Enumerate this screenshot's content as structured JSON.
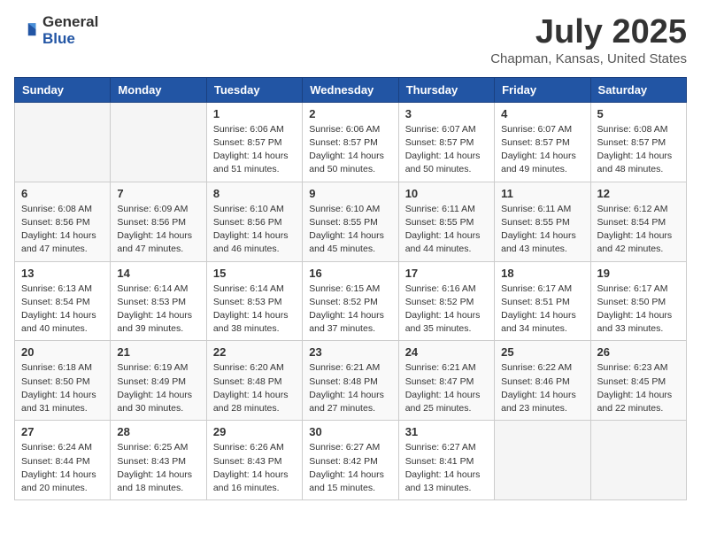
{
  "header": {
    "logo_general": "General",
    "logo_blue": "Blue",
    "title": "July 2025",
    "subtitle": "Chapman, Kansas, United States"
  },
  "weekdays": [
    "Sunday",
    "Monday",
    "Tuesday",
    "Wednesday",
    "Thursday",
    "Friday",
    "Saturday"
  ],
  "weeks": [
    [
      {
        "day": "",
        "sunrise": "",
        "sunset": "",
        "daylight": ""
      },
      {
        "day": "",
        "sunrise": "",
        "sunset": "",
        "daylight": ""
      },
      {
        "day": "1",
        "sunrise": "Sunrise: 6:06 AM",
        "sunset": "Sunset: 8:57 PM",
        "daylight": "Daylight: 14 hours and 51 minutes."
      },
      {
        "day": "2",
        "sunrise": "Sunrise: 6:06 AM",
        "sunset": "Sunset: 8:57 PM",
        "daylight": "Daylight: 14 hours and 50 minutes."
      },
      {
        "day": "3",
        "sunrise": "Sunrise: 6:07 AM",
        "sunset": "Sunset: 8:57 PM",
        "daylight": "Daylight: 14 hours and 50 minutes."
      },
      {
        "day": "4",
        "sunrise": "Sunrise: 6:07 AM",
        "sunset": "Sunset: 8:57 PM",
        "daylight": "Daylight: 14 hours and 49 minutes."
      },
      {
        "day": "5",
        "sunrise": "Sunrise: 6:08 AM",
        "sunset": "Sunset: 8:57 PM",
        "daylight": "Daylight: 14 hours and 48 minutes."
      }
    ],
    [
      {
        "day": "6",
        "sunrise": "Sunrise: 6:08 AM",
        "sunset": "Sunset: 8:56 PM",
        "daylight": "Daylight: 14 hours and 47 minutes."
      },
      {
        "day": "7",
        "sunrise": "Sunrise: 6:09 AM",
        "sunset": "Sunset: 8:56 PM",
        "daylight": "Daylight: 14 hours and 47 minutes."
      },
      {
        "day": "8",
        "sunrise": "Sunrise: 6:10 AM",
        "sunset": "Sunset: 8:56 PM",
        "daylight": "Daylight: 14 hours and 46 minutes."
      },
      {
        "day": "9",
        "sunrise": "Sunrise: 6:10 AM",
        "sunset": "Sunset: 8:55 PM",
        "daylight": "Daylight: 14 hours and 45 minutes."
      },
      {
        "day": "10",
        "sunrise": "Sunrise: 6:11 AM",
        "sunset": "Sunset: 8:55 PM",
        "daylight": "Daylight: 14 hours and 44 minutes."
      },
      {
        "day": "11",
        "sunrise": "Sunrise: 6:11 AM",
        "sunset": "Sunset: 8:55 PM",
        "daylight": "Daylight: 14 hours and 43 minutes."
      },
      {
        "day": "12",
        "sunrise": "Sunrise: 6:12 AM",
        "sunset": "Sunset: 8:54 PM",
        "daylight": "Daylight: 14 hours and 42 minutes."
      }
    ],
    [
      {
        "day": "13",
        "sunrise": "Sunrise: 6:13 AM",
        "sunset": "Sunset: 8:54 PM",
        "daylight": "Daylight: 14 hours and 40 minutes."
      },
      {
        "day": "14",
        "sunrise": "Sunrise: 6:14 AM",
        "sunset": "Sunset: 8:53 PM",
        "daylight": "Daylight: 14 hours and 39 minutes."
      },
      {
        "day": "15",
        "sunrise": "Sunrise: 6:14 AM",
        "sunset": "Sunset: 8:53 PM",
        "daylight": "Daylight: 14 hours and 38 minutes."
      },
      {
        "day": "16",
        "sunrise": "Sunrise: 6:15 AM",
        "sunset": "Sunset: 8:52 PM",
        "daylight": "Daylight: 14 hours and 37 minutes."
      },
      {
        "day": "17",
        "sunrise": "Sunrise: 6:16 AM",
        "sunset": "Sunset: 8:52 PM",
        "daylight": "Daylight: 14 hours and 35 minutes."
      },
      {
        "day": "18",
        "sunrise": "Sunrise: 6:17 AM",
        "sunset": "Sunset: 8:51 PM",
        "daylight": "Daylight: 14 hours and 34 minutes."
      },
      {
        "day": "19",
        "sunrise": "Sunrise: 6:17 AM",
        "sunset": "Sunset: 8:50 PM",
        "daylight": "Daylight: 14 hours and 33 minutes."
      }
    ],
    [
      {
        "day": "20",
        "sunrise": "Sunrise: 6:18 AM",
        "sunset": "Sunset: 8:50 PM",
        "daylight": "Daylight: 14 hours and 31 minutes."
      },
      {
        "day": "21",
        "sunrise": "Sunrise: 6:19 AM",
        "sunset": "Sunset: 8:49 PM",
        "daylight": "Daylight: 14 hours and 30 minutes."
      },
      {
        "day": "22",
        "sunrise": "Sunrise: 6:20 AM",
        "sunset": "Sunset: 8:48 PM",
        "daylight": "Daylight: 14 hours and 28 minutes."
      },
      {
        "day": "23",
        "sunrise": "Sunrise: 6:21 AM",
        "sunset": "Sunset: 8:48 PM",
        "daylight": "Daylight: 14 hours and 27 minutes."
      },
      {
        "day": "24",
        "sunrise": "Sunrise: 6:21 AM",
        "sunset": "Sunset: 8:47 PM",
        "daylight": "Daylight: 14 hours and 25 minutes."
      },
      {
        "day": "25",
        "sunrise": "Sunrise: 6:22 AM",
        "sunset": "Sunset: 8:46 PM",
        "daylight": "Daylight: 14 hours and 23 minutes."
      },
      {
        "day": "26",
        "sunrise": "Sunrise: 6:23 AM",
        "sunset": "Sunset: 8:45 PM",
        "daylight": "Daylight: 14 hours and 22 minutes."
      }
    ],
    [
      {
        "day": "27",
        "sunrise": "Sunrise: 6:24 AM",
        "sunset": "Sunset: 8:44 PM",
        "daylight": "Daylight: 14 hours and 20 minutes."
      },
      {
        "day": "28",
        "sunrise": "Sunrise: 6:25 AM",
        "sunset": "Sunset: 8:43 PM",
        "daylight": "Daylight: 14 hours and 18 minutes."
      },
      {
        "day": "29",
        "sunrise": "Sunrise: 6:26 AM",
        "sunset": "Sunset: 8:43 PM",
        "daylight": "Daylight: 14 hours and 16 minutes."
      },
      {
        "day": "30",
        "sunrise": "Sunrise: 6:27 AM",
        "sunset": "Sunset: 8:42 PM",
        "daylight": "Daylight: 14 hours and 15 minutes."
      },
      {
        "day": "31",
        "sunrise": "Sunrise: 6:27 AM",
        "sunset": "Sunset: 8:41 PM",
        "daylight": "Daylight: 14 hours and 13 minutes."
      },
      {
        "day": "",
        "sunrise": "",
        "sunset": "",
        "daylight": ""
      },
      {
        "day": "",
        "sunrise": "",
        "sunset": "",
        "daylight": ""
      }
    ]
  ]
}
